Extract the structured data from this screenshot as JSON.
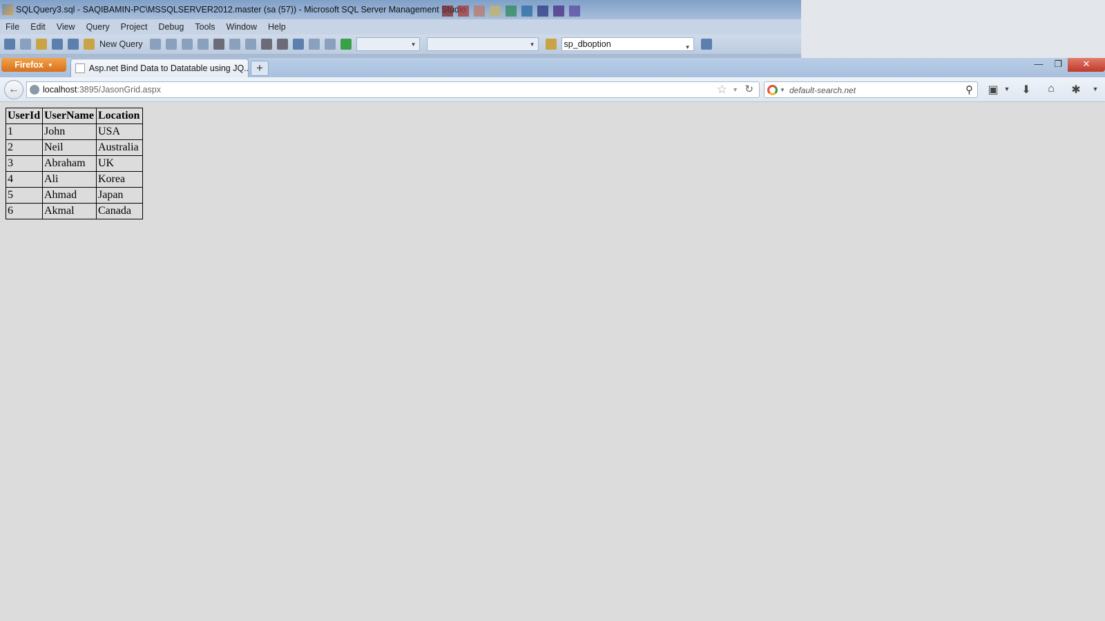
{
  "ssms": {
    "title": "SQLQuery3.sql - SAQIBAMIN-PC\\MSSQLSERVER2012.master (sa (57)) - Microsoft SQL Server Management Studio",
    "menu": [
      "File",
      "Edit",
      "View",
      "Query",
      "Project",
      "Debug",
      "Tools",
      "Window",
      "Help"
    ],
    "toolbar": {
      "new_query_label": "New Query",
      "database_combo_value": "sp_dboption"
    }
  },
  "firefox": {
    "app_button_label": "Firefox",
    "tab": {
      "title": "Asp.net Bind Data to Datatable using JQ..."
    },
    "new_tab_label": "+",
    "url": {
      "host": "localhost",
      "rest": ":3895/JasonGrid.aspx"
    },
    "search": {
      "placeholder": "default-search.net"
    }
  },
  "grid": {
    "columns": [
      "UserId",
      "UserName",
      "Location"
    ],
    "rows": [
      [
        "1",
        "John",
        "USA"
      ],
      [
        "2",
        "Neil",
        "Australia"
      ],
      [
        "3",
        "Abraham",
        "UK"
      ],
      [
        "4",
        "Ali",
        "Korea"
      ],
      [
        "5",
        "Ahmad",
        "Japan"
      ],
      [
        "6",
        "Akmal",
        "Canada"
      ]
    ]
  },
  "colors": {
    "firefox_button": "#e8872f",
    "close_button": "#c0392b",
    "page_background": "#dcdcdc"
  }
}
